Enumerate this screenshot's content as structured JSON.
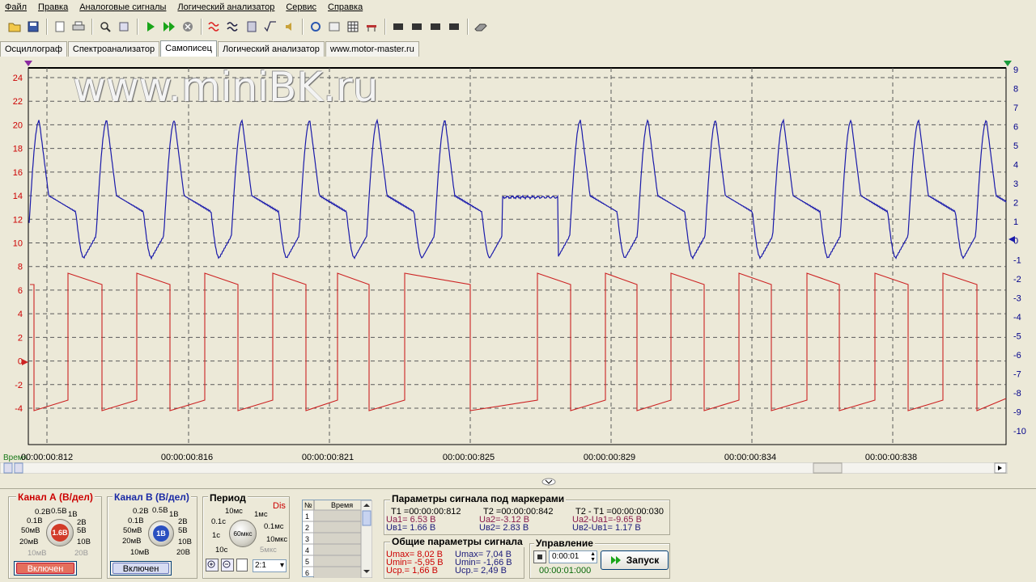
{
  "menu": [
    "Файл",
    "Правка",
    "Аналоговые сигналы",
    "Логический анализатор",
    "Сервис",
    "Справка"
  ],
  "tabs": [
    {
      "label": "Осциллограф",
      "active": false
    },
    {
      "label": "Спектроанализатор",
      "active": false
    },
    {
      "label": "Самописец",
      "active": true
    },
    {
      "label": "Логический анализатор",
      "active": false
    },
    {
      "label": "www.motor-master.ru",
      "active": false
    }
  ],
  "watermark": "www.miniBK.ru",
  "plot": {
    "left_axis_ticks": [
      "24",
      "22",
      "20",
      "18",
      "16",
      "14",
      "12",
      "10",
      "8",
      "6",
      "4",
      "2",
      "0",
      "-2",
      "-4"
    ],
    "right_axis_ticks": [
      "9",
      "8",
      "7",
      "6",
      "5",
      "4",
      "3",
      "2",
      "1",
      "0",
      "-1",
      "-2",
      "-3",
      "-4",
      "-5",
      "-6",
      "-7",
      "-8",
      "-9",
      "-10"
    ],
    "time_label_prefix": "Время",
    "time_ticks": [
      "00:00:00:812",
      "00:00:00:816",
      "00:00:00:821",
      "00:00:00:825",
      "00:00:00:829",
      "00:00:00:834",
      "00:00:00:838"
    ],
    "colors": {
      "channel_a": "#cc2222",
      "channel_b": "#1a1aaa",
      "grid": "#5a5a5a",
      "left_axis": "#cc0000",
      "right_axis": "#00008b"
    }
  },
  "channel_a": {
    "title": "Канал А (В/дел)",
    "knob_value": "1.6В",
    "scale_labels": [
      "0.2В",
      "0.5В",
      "1В",
      "0.1В",
      "2В",
      "50мВ",
      "5В",
      "20мВ",
      "10В",
      "10мВ",
      "20В"
    ],
    "button": "Включен"
  },
  "channel_b": {
    "title": "Канал В (В/дел)",
    "knob_value": "1В",
    "scale_labels": [
      "0.2В",
      "0.5В",
      "1В",
      "0.1В",
      "2В",
      "50мВ",
      "5В",
      "20мВ",
      "10В",
      "10мВ",
      "20В"
    ],
    "button": "Включен"
  },
  "period": {
    "title": "Период",
    "dis": "Dis",
    "knob_value": "60мкс",
    "scale_labels": [
      "10мс",
      "1мс",
      "0.1с",
      "0.1мс",
      "1с",
      "10мкс",
      "10с",
      "5мкс"
    ],
    "ratio": "2:1"
  },
  "table": {
    "col_num": "№",
    "col_time": "Время",
    "rows": [
      "1",
      "2",
      "3",
      "4",
      "5",
      "6"
    ]
  },
  "markers": {
    "title": "Параметры сигнала под маркерами",
    "t1": "T1 =00:00:00:812",
    "t2": "T2 =00:00:00:842",
    "dt": "T2 - T1 =00:00:00:030",
    "ua1": "Ua1= 6.53 В",
    "ub1": "Uв1= 1.66 В",
    "ua2": "Ua2=-3.12 В",
    "ub2": "Uв2= 2.83 В",
    "dua": "Ua2-Ua1=-9.65 В",
    "dub": "Uв2-Uв1= 1.17 В"
  },
  "general": {
    "title": "Общие параметры сигнала",
    "a_max": "Umax= 8,02 В",
    "a_min": "Umin= -5,95 В",
    "a_avg": "Ucp.= 1,66 В",
    "b_max": "Umax= 7,04 В",
    "b_min": "Umin= -1,66 В",
    "b_avg": "Ucp.= 2,49 В"
  },
  "control": {
    "title": "Управление",
    "spinner_value": "0:00:01",
    "elapsed": "00:00:01:000",
    "run_label": "Запуск"
  }
}
